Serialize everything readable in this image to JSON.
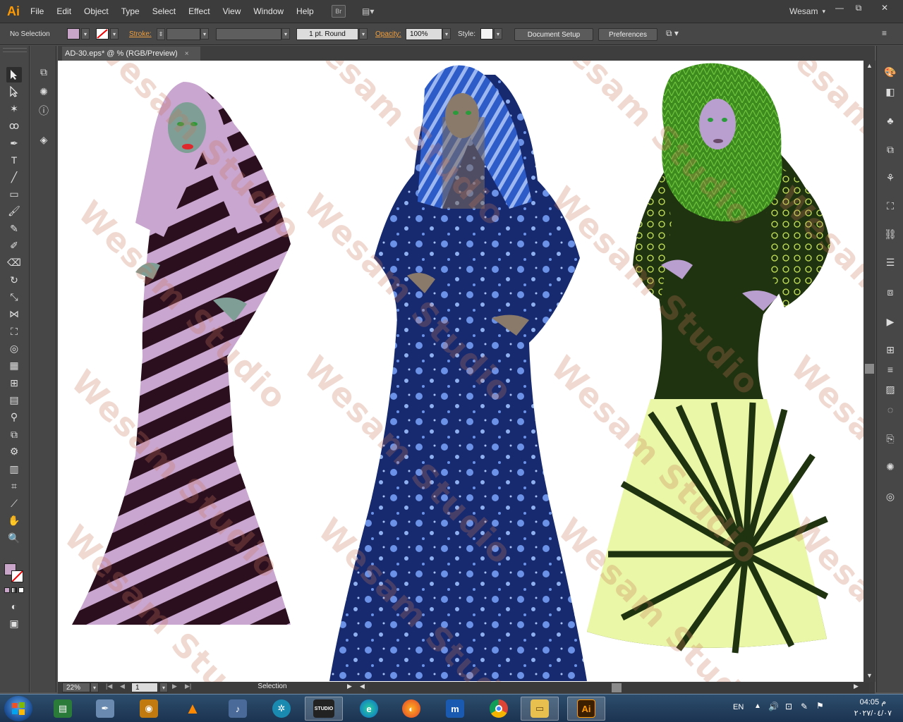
{
  "app": {
    "logo_text": "Ai",
    "user": "Wesam",
    "user_caret": "▾"
  },
  "menu": [
    "File",
    "Edit",
    "Object",
    "Type",
    "Select",
    "Effect",
    "View",
    "Window",
    "Help"
  ],
  "menu_extra": {
    "bridge": "Br",
    "arrange": "▤▾"
  },
  "window_controls": {
    "minimize": "—",
    "restore": "⧉",
    "close": "✕"
  },
  "control_bar": {
    "selection": "No Selection",
    "fill_color": "#c9a6c9",
    "stroke_label": "Stroke:",
    "stroke_weight": "",
    "brush": "1 pt. Round",
    "opacity_label": "Opacity:",
    "opacity": "100%",
    "style_label": "Style:",
    "document_setup": "Document Setup",
    "preferences": "Preferences"
  },
  "document_tab": {
    "title": "AD-30.eps* @ % (RGB/Preview)",
    "close": "×"
  },
  "canvas": {
    "watermark": "Wesam Studio",
    "figures": [
      {
        "name": "figure-pink",
        "dress_colors": [
          "#c9a6cf",
          "#2b0f1f"
        ],
        "skin": "#7f9f96"
      },
      {
        "name": "figure-blue",
        "dress_colors": [
          "#1a2a6e",
          "#6b92e6"
        ],
        "skin": "#8a7a6a"
      },
      {
        "name": "figure-green",
        "dress_colors": [
          "#1f3310",
          "#e9f7a6"
        ],
        "skin": "#b99fcf"
      }
    ]
  },
  "status_bar": {
    "zoom": "22%",
    "page": "1",
    "tool": "Selection"
  },
  "taskbar": {
    "apps": [
      "explorer-monitor",
      "pen-tool",
      "eye-app",
      "vlc",
      "media-app",
      "codec",
      "studio",
      "edge",
      "firefox",
      "maxthon",
      "chrome",
      "file-explorer",
      "illustrator"
    ],
    "illustrator_label": "Ai",
    "studio_label": "STUDIO",
    "language": "EN",
    "time": "04:05 م",
    "date": "٢٠٢٧/٠٤/٠٧"
  }
}
